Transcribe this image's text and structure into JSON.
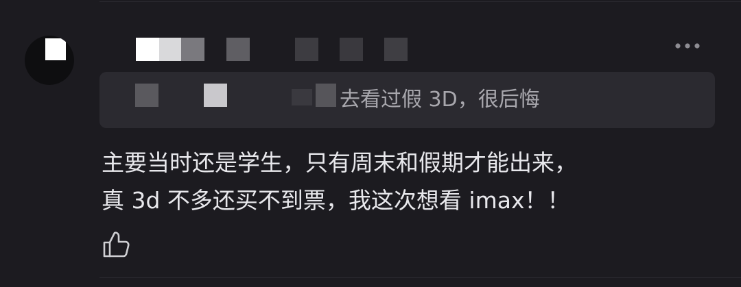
{
  "comment": {
    "quoted_text": "去看过假 3D，很后悔",
    "body_lines": [
      "主要当时还是学生，只有周末和假期才能出来，",
      "真 3d 不多还买不到票，我这次想看 imax！！"
    ]
  },
  "icons": {
    "more": "more-horizontal-icon",
    "like": "thumbs-up-icon"
  },
  "colors": {
    "background": "#1c1b20",
    "quote_background": "#2b2a30",
    "quote_text": "#a8a7ad",
    "body_text": "#e8e8ec"
  }
}
